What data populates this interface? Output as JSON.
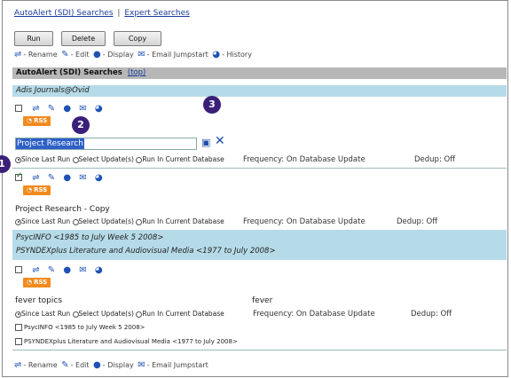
{
  "top_links": {
    "autoalert": "AutoAlert (SDI) Searches",
    "expert": "Expert Searches"
  },
  "toolbar": {
    "run": "Run",
    "delete": "Delete",
    "copy": "Copy"
  },
  "legend": {
    "rename": "- Rename",
    "edit": "- Edit",
    "display": "- Display",
    "email": "- Email Jumpstart",
    "history": "- History"
  },
  "header": {
    "title": "AutoAlert (SDI) Searches",
    "top_link": "(top)"
  },
  "groups": [
    {
      "db": "Adis Journals@Ovid"
    },
    {
      "db1": "PsycINFO <1985 to July Week 5 2008>",
      "db2": "PSYNDEXplus Literature and Audiovisual Media <1977 to July 2008>"
    }
  ],
  "rss": "RSS",
  "searches": [
    {
      "name": "Project Research",
      "frequency": "Frequency: On Database Update",
      "dedup": "Dedup: Off"
    },
    {
      "name": "Project Research - Copy",
      "frequency": "Frequency: On Database Update",
      "dedup": "Dedup: Off"
    },
    {
      "name": "fever topics",
      "alias": "fever",
      "frequency": "Frequency: On Database Update",
      "dedup": "Dedup: Off"
    }
  ],
  "radios": {
    "since": "Since Last Run",
    "select": "Select Update(s)",
    "current": "Run In Current Database"
  },
  "db_checks": [
    "PsycINFO <1985 to July Week 5 2008>",
    "PSYNDEXplus Literature and Audiovisual Media <1977 to July 2008>"
  ],
  "callouts": [
    "1",
    "2",
    "3"
  ]
}
